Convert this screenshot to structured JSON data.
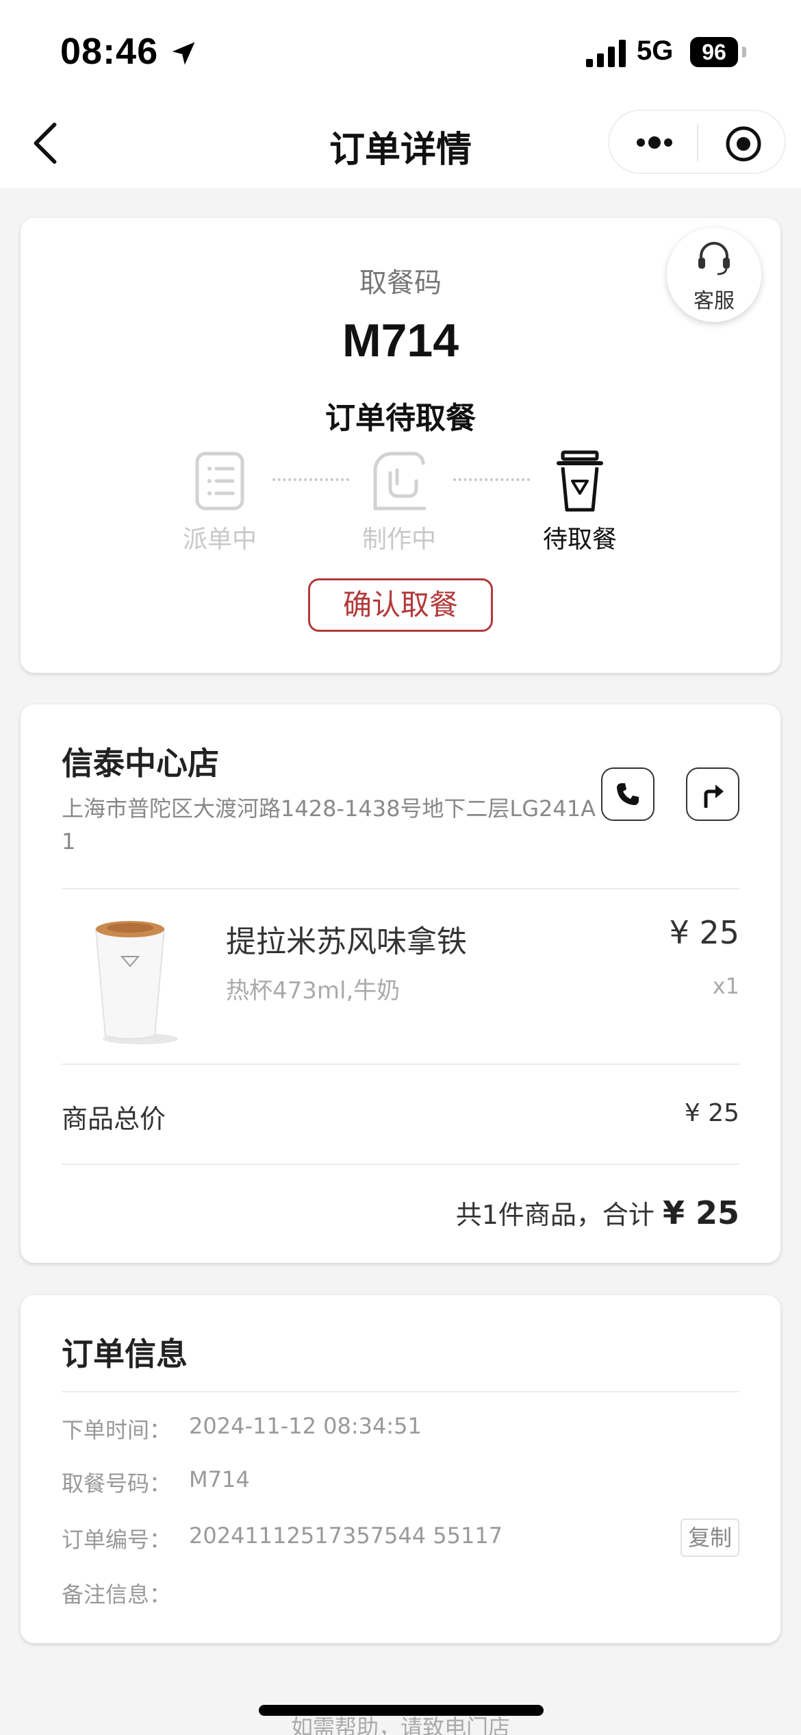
{
  "status_bar": {
    "time": "08:46",
    "network": "5G",
    "battery": "96"
  },
  "nav": {
    "title": "订单详情"
  },
  "pickup": {
    "service_label": "客服",
    "code_label": "取餐码",
    "code": "M714",
    "status": "订单待取餐",
    "steps": [
      {
        "label": "派单中",
        "icon": "order-list-icon",
        "active": false
      },
      {
        "label": "制作中",
        "icon": "coffee-machine-icon",
        "active": false
      },
      {
        "label": "待取餐",
        "icon": "cup-icon",
        "active": true
      }
    ],
    "confirm_label": "确认取餐",
    "accent_color": "#b23a3a"
  },
  "store": {
    "name": "信泰中心店",
    "address": "上海市普陀区大渡河路1428-1438号地下二层LG241A1",
    "product": {
      "name": "提拉米苏风味拿铁",
      "spec": "热杯473ml,牛奶",
      "price": "¥ 25",
      "qty": "x1"
    },
    "subtotal_label": "商品总价",
    "subtotal_value": "¥ 25",
    "total_prefix": "共1件商品，合计 ",
    "total_amount": "¥ 25"
  },
  "order_info": {
    "title": "订单信息",
    "rows": [
      {
        "key": "下单时间：",
        "value": "2024-11-12 08:34:51"
      },
      {
        "key": "取餐号码：",
        "value": "M714"
      },
      {
        "key": "订单编号：",
        "value": "20241112517357544 55117"
      },
      {
        "key": "备注信息：",
        "value": ""
      }
    ],
    "copy_label": "复制"
  },
  "footer": {
    "help_prefix": "如需帮助，请致",
    "help_link": "电门店"
  }
}
